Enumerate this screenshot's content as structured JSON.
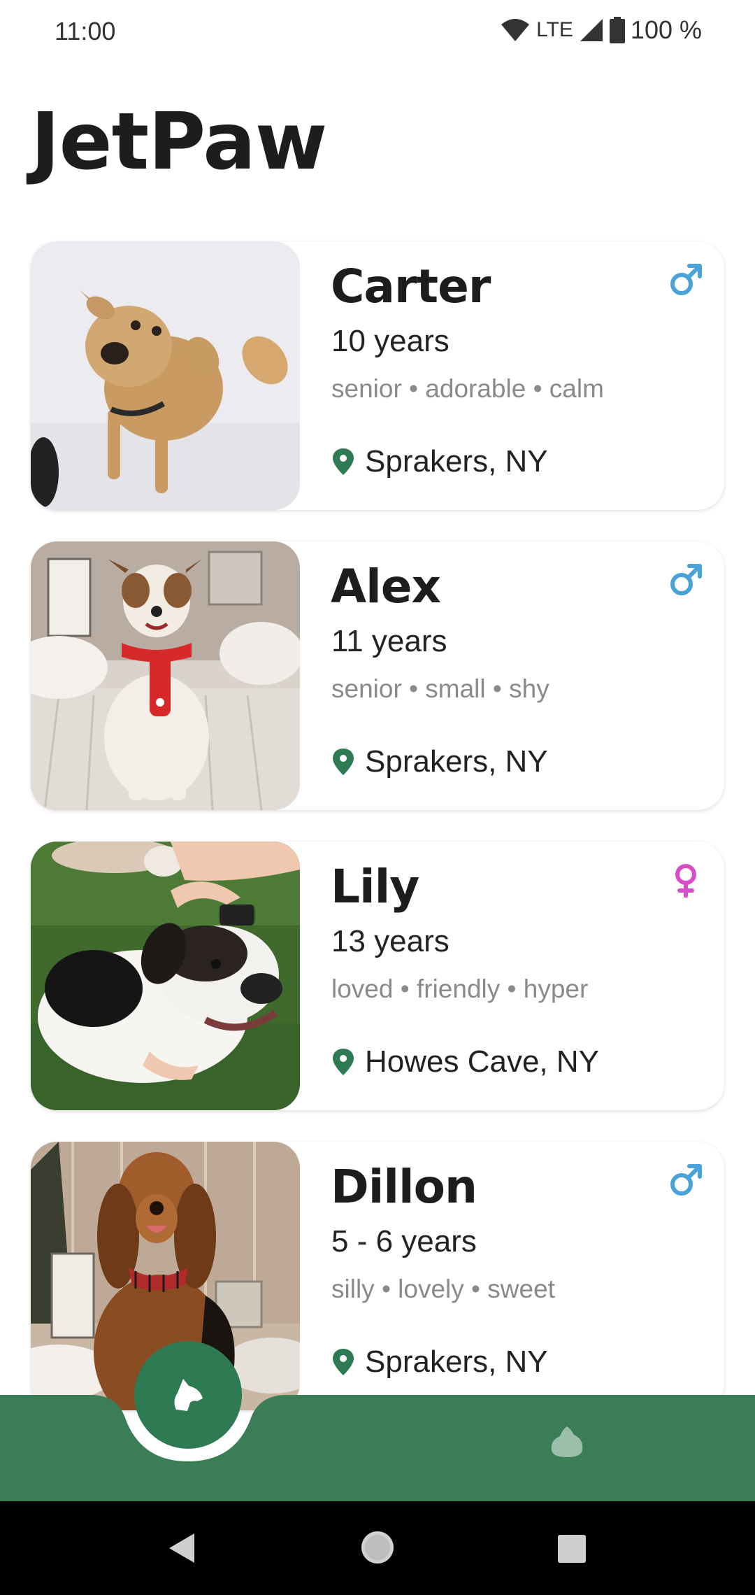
{
  "status_bar": {
    "time": "11:00",
    "network": "LTE",
    "battery": "100 %"
  },
  "app": {
    "title": "JetPaw"
  },
  "pets": [
    {
      "name": "Carter",
      "age": "10 years",
      "tags": "senior • adorable • calm",
      "location": "Sprakers, NY",
      "gender": "male"
    },
    {
      "name": "Alex",
      "age": "11 years",
      "tags": "senior • small • shy",
      "location": "Sprakers, NY",
      "gender": "male"
    },
    {
      "name": "Lily",
      "age": "13 years",
      "tags": "loved • friendly • hyper",
      "location": "Howes Cave, NY",
      "gender": "female"
    },
    {
      "name": "Dillon",
      "age": "5 - 6 years",
      "tags": "silly • lovely • sweet",
      "location": "Sprakers, NY",
      "gender": "male"
    }
  ],
  "bottom_nav": {
    "items": [
      "dog-head-icon",
      "paw-icon"
    ],
    "selected": "dog-head-icon"
  },
  "colors": {
    "accent_green": "#2e7a52",
    "male_blue": "#4aa3d8",
    "female_pink": "#d64fc6",
    "tag_gray": "#8a8a8a"
  }
}
